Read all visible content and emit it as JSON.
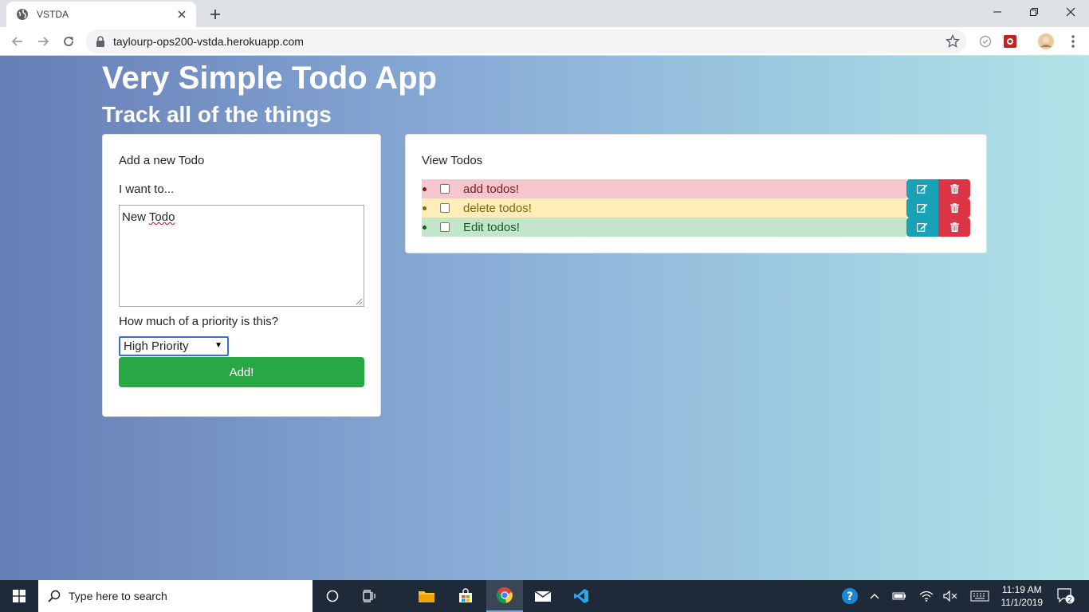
{
  "browser": {
    "tab_title": "VSTDA",
    "url": "taylourp-ops200-vstda.herokuapp.com"
  },
  "page": {
    "title": "Very Simple Todo App",
    "subtitle": "Track all of the things"
  },
  "add_form": {
    "card_title": "Add a new Todo",
    "text_label": "I want to...",
    "text_value_first": "New",
    "text_value_second": "Todo",
    "priority_label": "How much of a priority is this?",
    "priority_selected": "High Priority",
    "add_label": "Add!"
  },
  "view": {
    "card_title": "View Todos",
    "todos": [
      {
        "text": "add todos!",
        "priority": "high",
        "bg": "#f5c6cb",
        "fg": "#721c24"
      },
      {
        "text": "delete todos!",
        "priority": "medium",
        "bg": "#ffeeba",
        "fg": "#856404"
      },
      {
        "text": "Edit todos!",
        "priority": "low",
        "bg": "#c3e6cb",
        "fg": "#155724"
      }
    ]
  },
  "taskbar": {
    "search_placeholder": "Type here to search",
    "time": "11:19 AM",
    "date": "11/1/2019",
    "notification_count": "2"
  }
}
